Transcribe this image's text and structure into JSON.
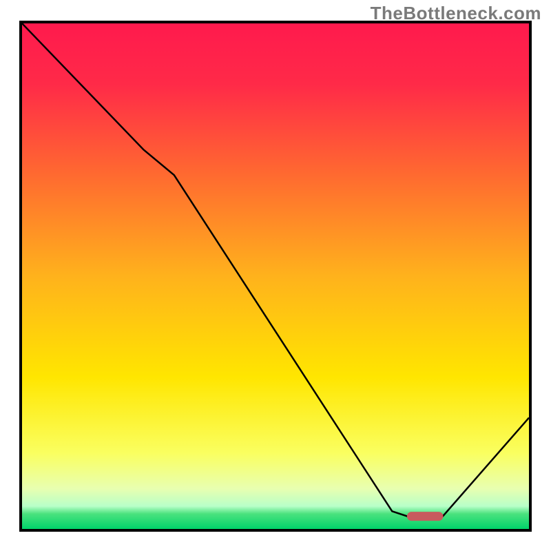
{
  "watermark": "TheBottleneck.com",
  "chart_data": {
    "type": "line",
    "x": [
      0,
      24,
      30,
      73,
      76,
      83,
      100
    ],
    "y": [
      100,
      75,
      70,
      3.5,
      2.5,
      2.5,
      22
    ],
    "xlim": [
      0,
      100
    ],
    "ylim": [
      0,
      100
    ],
    "xlabel": "",
    "ylabel": "",
    "title": "",
    "grid": false,
    "marker": {
      "type": "rounded-bar",
      "x_start": 76,
      "x_end": 83,
      "y": 2.5,
      "color": "#c85a5e"
    },
    "gradient_stops": [
      {
        "pos": 0.0,
        "color": "#ff1a4d"
      },
      {
        "pos": 0.12,
        "color": "#ff2a48"
      },
      {
        "pos": 0.3,
        "color": "#ff6a30"
      },
      {
        "pos": 0.5,
        "color": "#ffb21c"
      },
      {
        "pos": 0.7,
        "color": "#ffe600"
      },
      {
        "pos": 0.85,
        "color": "#faff60"
      },
      {
        "pos": 0.92,
        "color": "#e8ffb0"
      },
      {
        "pos": 0.955,
        "color": "#b8ffc8"
      },
      {
        "pos": 0.97,
        "color": "#4be27e"
      },
      {
        "pos": 1.0,
        "color": "#00d36a"
      }
    ],
    "annotations": []
  }
}
